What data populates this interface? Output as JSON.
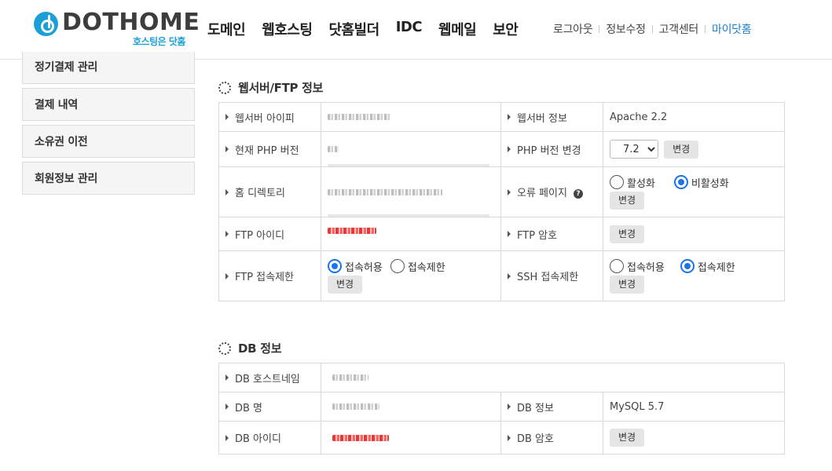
{
  "brand": {
    "name": "DOTHOME",
    "tagline": "호스팅은 닷홈",
    "color": "#19a0d8"
  },
  "gnb": [
    "도메인",
    "웹호스팅",
    "닷홈빌더",
    "IDC",
    "웹메일",
    "보안"
  ],
  "util": [
    "로그아웃",
    "정보수정",
    "고객센터",
    "마이닷홈"
  ],
  "sidebar": [
    "정기결제 관리",
    "결제 내역",
    "소유권 이전",
    "회원정보 관리"
  ],
  "web": {
    "title": "웹서버/FTP 정보",
    "ip_label": "웹서버 아이피",
    "server_info_label": "웹서버 정보",
    "server_info": "Apache 2.2",
    "php_label": "현재 PHP 버전",
    "php_change_label": "PHP 버전 변경",
    "php_selected": "7.2",
    "change": "변경",
    "home_label": "홈 디렉토리",
    "error_page_label": "오류 페이지",
    "activate": "활성화",
    "deactivate": "비활성화",
    "ftp_id_label": "FTP 아이디",
    "ftp_pw_label": "FTP 암호",
    "ftp_limit_label": "FTP 접속제한",
    "ssh_limit_label": "SSH 접속제한",
    "allow": "접속허용",
    "deny": "접속제한"
  },
  "db": {
    "title": "DB 정보",
    "host_label": "DB 호스트네임",
    "name_label": "DB 명",
    "info_label": "DB 정보",
    "info": "MySQL 5.7",
    "id_label": "DB 아이디",
    "pw_label": "DB 암호",
    "change": "변경"
  }
}
